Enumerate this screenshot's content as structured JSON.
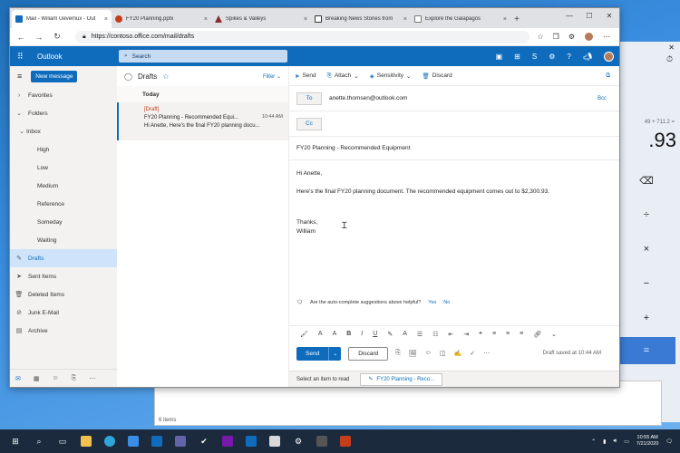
{
  "browser": {
    "tabs": [
      {
        "label": "Mail - Wiliam Uevemux - Out",
        "color": "#0f6cbd"
      },
      {
        "label": "FY20 Planning.pptx",
        "color": "#c43e1c"
      },
      {
        "label": "Spikes & Valleys",
        "color": "#8b2b2b"
      },
      {
        "label": "Breaking News Stories from",
        "color": "#333333"
      },
      {
        "label": "Explore the Galapagos",
        "color": "#3a7d44"
      }
    ],
    "url": "https://contoso.office.com/mail/drafts"
  },
  "outlook": {
    "app_name": "Outlook",
    "search_placeholder": "Search",
    "new_message": "New message",
    "nav": {
      "favorites": "Favorites",
      "folders": "Folders",
      "inbox": "Inbox",
      "subfolders": [
        "High",
        "Low",
        "Medium",
        "Reference",
        "Someday",
        "Waiting"
      ],
      "drafts": "Drafts",
      "sent": "Sent Items",
      "deleted": "Deleted Items",
      "junk": "Junk E-Mail",
      "archive": "Archive"
    },
    "list": {
      "title": "Drafts",
      "filter": "Filter",
      "group": "Today",
      "item": {
        "tag": "[Draft]",
        "subject": "FY20 Planning - Recommended Equi...",
        "time": "10:44 AM",
        "preview": "Hi Anette, Here's the final FY20 planning docu..."
      }
    },
    "compose": {
      "commands": [
        "Send",
        "Attach",
        "Sensitivity",
        "Discard"
      ],
      "to_label": "To",
      "to_value": "anette.thomsen@outlook.com",
      "bcc": "Bcc",
      "cc_label": "Cc",
      "subject": "FY20 Planning - Recommended Equipment",
      "greeting": "Hi Anette,",
      "body": "Here's the final FY20 planning document. The recommended equipment comes out to $2,300.93.",
      "closing": "Thanks,",
      "signature": "William",
      "suggest_question": "Are the auto-complete suggestions above helpful?",
      "yes": "Yes",
      "no": "No",
      "send": "Send",
      "discard": "Discard",
      "saved": "Draft saved at 10:44 AM"
    },
    "status": {
      "select_prompt": "Select an item to read",
      "draft_tab": "FY20 Planning - Reco..."
    }
  },
  "calculator": {
    "expr": "49 + 711.2 =",
    "display": ".93"
  },
  "explorer": {
    "items": "6 items"
  },
  "taskbar": {
    "time": "10:55 AM",
    "date": "7/21/2020"
  }
}
